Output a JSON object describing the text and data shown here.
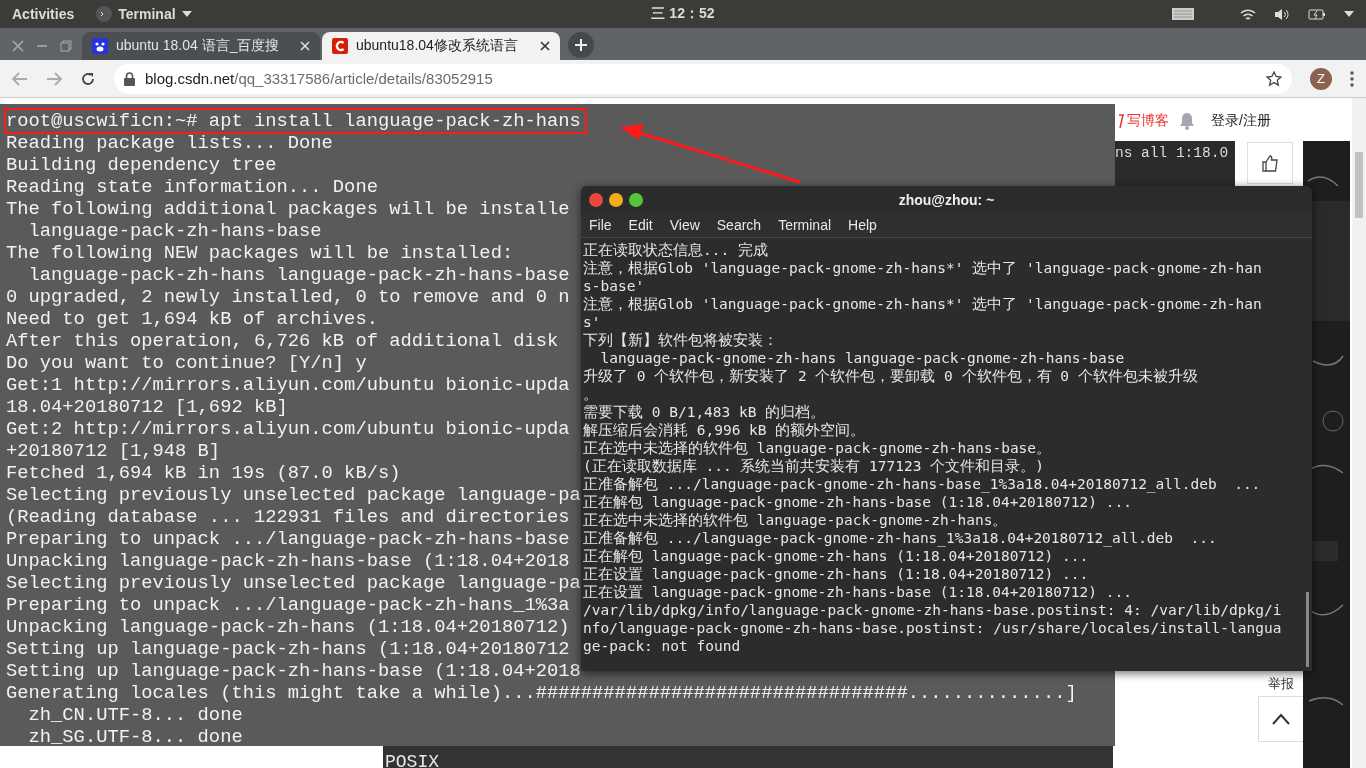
{
  "top_bar": {
    "activities": "Activities",
    "app_menu": "Terminal",
    "clock": "三 12：52"
  },
  "browser": {
    "tabs": [
      {
        "title": "ubuntu 18.04 语言_百度搜",
        "selected": false
      },
      {
        "title": "ubuntu18.04修改系统语言",
        "selected": true
      }
    ],
    "url": {
      "host": "blog.csdn.net",
      "path": "/qq_33317586/article/details/83052915"
    },
    "avatar": "Z"
  },
  "blog": {
    "write_link": "写博客",
    "login_link": "登录/注册",
    "snippet": "ns all 1:18.0",
    "report": "举报",
    "lower_text": "POSIX"
  },
  "screenshot_terminal": {
    "lines": [
      {
        "text": "root@uscwificn:~# apt install language-pack-zh-hans",
        "highlighted": true
      },
      {
        "text": "Reading package lists... Done",
        "highlighted": false
      },
      {
        "text": "Building dependency tree",
        "highlighted": false
      },
      {
        "text": "Reading state information... Done",
        "highlighted": false
      },
      {
        "text": "The following additional packages will be installe",
        "highlighted": false
      },
      {
        "text": "  language-pack-zh-hans-base",
        "highlighted": false
      },
      {
        "text": "The following NEW packages will be installed:",
        "highlighted": false
      },
      {
        "text": "  language-pack-zh-hans language-pack-zh-hans-base",
        "highlighted": false
      },
      {
        "text": "0 upgraded, 2 newly installed, 0 to remove and 0 n",
        "highlighted": false
      },
      {
        "text": "Need to get 1,694 kB of archives.",
        "highlighted": false
      },
      {
        "text": "After this operation, 6,726 kB of additional disk",
        "highlighted": false
      },
      {
        "text": "Do you want to continue? [Y/n] y",
        "highlighted": false
      },
      {
        "text": "Get:1 http://mirrors.aliyun.com/ubuntu bionic-upda",
        "highlighted": false
      },
      {
        "text": "18.04+20180712 [1,692 kB]",
        "highlighted": false
      },
      {
        "text": "Get:2 http://mirrors.aliyun.com/ubuntu bionic-upda",
        "highlighted": false
      },
      {
        "text": "+20180712 [1,948 B]",
        "highlighted": false
      },
      {
        "text": "Fetched 1,694 kB in 19s (87.0 kB/s)",
        "highlighted": false
      },
      {
        "text": "Selecting previously unselected package language-pa",
        "highlighted": false
      },
      {
        "text": "(Reading database ... 122931 files and directories",
        "highlighted": false
      },
      {
        "text": "Preparing to unpack .../language-pack-zh-hans-base",
        "highlighted": false
      },
      {
        "text": "Unpacking language-pack-zh-hans-base (1:18.04+2018",
        "highlighted": false
      },
      {
        "text": "Selecting previously unselected package language-pa",
        "highlighted": false
      },
      {
        "text": "Preparing to unpack .../language-pack-zh-hans_1%3a",
        "highlighted": false
      },
      {
        "text": "Unpacking language-pack-zh-hans (1:18.04+20180712)",
        "highlighted": false
      },
      {
        "text": "Setting up language-pack-zh-hans (1:18.04+20180712",
        "highlighted": false
      },
      {
        "text": "Setting up language-pack-zh-hans-base (1:18.04+2018",
        "highlighted": false
      },
      {
        "text": "Generating locales (this might take a while)...#################################..............]",
        "highlighted": false
      },
      {
        "text": "  zh_CN.UTF-8... done",
        "highlighted": false
      },
      {
        "text": "  zh_SG.UTF-8... done",
        "highlighted": false
      }
    ]
  },
  "terminal_window": {
    "title": "zhou@zhou: ~",
    "menu": [
      "File",
      "Edit",
      "View",
      "Search",
      "Terminal",
      "Help"
    ],
    "lines": [
      "正在读取状态信息... 完成",
      "注意，根据Glob 'language-pack-gnome-zh-hans*' 选中了 'language-pack-gnome-zh-han",
      "s-base'",
      "注意，根据Glob 'language-pack-gnome-zh-hans*' 选中了 'language-pack-gnome-zh-han",
      "s'",
      "下列【新】软件包将被安装：",
      "  language-pack-gnome-zh-hans language-pack-gnome-zh-hans-base",
      "升级了 0 个软件包，新安装了 2 个软件包，要卸载 0 个软件包，有 0 个软件包未被升级",
      "。",
      "需要下载 0 B/1,483 kB 的归档。",
      "解压缩后会消耗 6,996 kB 的额外空间。",
      "正在选中未选择的软件包 language-pack-gnome-zh-hans-base。",
      "(正在读取数据库 ... 系统当前共安装有 177123 个文件和目录。)",
      "正准备解包 .../language-pack-gnome-zh-hans-base_1%3a18.04+20180712_all.deb  ...",
      "正在解包 language-pack-gnome-zh-hans-base (1:18.04+20180712) ...",
      "正在选中未选择的软件包 language-pack-gnome-zh-hans。",
      "正准备解包 .../language-pack-gnome-zh-hans_1%3a18.04+20180712_all.deb  ...",
      "正在解包 language-pack-gnome-zh-hans (1:18.04+20180712) ...",
      "正在设置 language-pack-gnome-zh-hans (1:18.04+20180712) ...",
      "正在设置 language-pack-gnome-zh-hans-base (1:18.04+20180712) ...",
      "/var/lib/dpkg/info/language-pack-gnome-zh-hans-base.postinst: 4: /var/lib/dpkg/i",
      "nfo/language-pack-gnome-zh-hans-base.postinst: /usr/share/locales/install-langua",
      "ge-pack: not found"
    ]
  }
}
